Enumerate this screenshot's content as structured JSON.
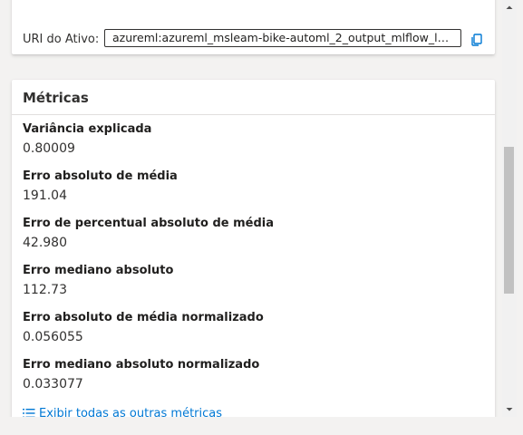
{
  "asset": {
    "cut_text_prefix": "",
    "cut_text_link": "",
    "uri_label": "URI do Ativo:",
    "uri_value": "azureml:azureml_msleam-bike-automl_2_output_mlflow_lo..."
  },
  "metrics_card": {
    "title": "Métricas",
    "items": [
      {
        "name": "Variância explicada",
        "value": "0.80009"
      },
      {
        "name": "Erro absoluto de média",
        "value": "191.04"
      },
      {
        "name": "Erro de percentual absoluto de média",
        "value": "42.980"
      },
      {
        "name": "Erro mediano absoluto",
        "value": "112.73"
      },
      {
        "name": "Erro absoluto de média normalizado",
        "value": "0.056055"
      },
      {
        "name": "Erro mediano absoluto normalizado",
        "value": "0.033077"
      }
    ],
    "more_link": "Exibir todas as outras métricas"
  },
  "colors": {
    "accent": "#0078d4",
    "text": "#323130",
    "scrollbar_thumb": "#c1c1c1"
  },
  "icons": {
    "copy": "copy-icon",
    "list": "list-icon",
    "scroll_up": "chevron-up-icon",
    "scroll_down": "chevron-down-icon"
  }
}
